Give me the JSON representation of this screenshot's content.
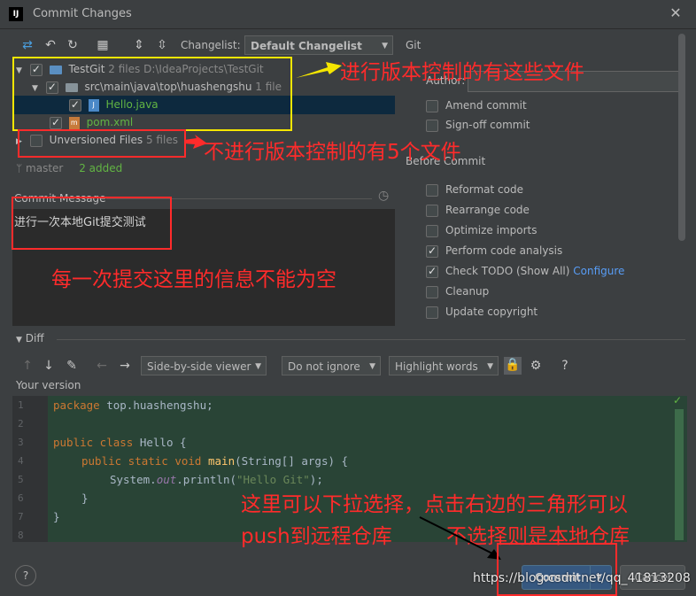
{
  "window": {
    "title": "Commit Changes",
    "close": "✕"
  },
  "toolbar": {
    "changelist_label": "Changelist:",
    "changelist_value": "Default Changelist",
    "git_label": "Git"
  },
  "tree": {
    "root": {
      "name": "TestGit",
      "count": "2 files",
      "path": "D:\\IdeaProjects\\TestGit"
    },
    "pkg": {
      "name": "src\\main\\java\\top\\huashengshu",
      "count": "1 file"
    },
    "file1": "Hello.java",
    "file2": "pom.xml",
    "unversioned": {
      "name": "Unversioned Files",
      "count": "5 files"
    }
  },
  "branch": {
    "name": "master",
    "status": "2 added"
  },
  "commit_message": {
    "label": "Commit Message",
    "value": "进行一次本地Git提交测试"
  },
  "right": {
    "author_label": "Author:",
    "amend": "Amend commit",
    "signoff": "Sign-off commit",
    "before_commit": "Before Commit",
    "reformat": "Reformat code",
    "rearrange": "Rearrange code",
    "optimize": "Optimize imports",
    "analysis": "Perform code analysis",
    "todo": "Check TODO (Show All)",
    "configure": "Configure",
    "cleanup": "Cleanup",
    "copyright": "Update copyright"
  },
  "diff": {
    "title": "Diff",
    "viewer": "Side-by-side viewer",
    "ignore": "Do not ignore",
    "highlight": "Highlight words",
    "help": "?",
    "your_version": "Your version"
  },
  "code": {
    "numbers": [
      "1",
      "2",
      "3",
      "4",
      "5",
      "6",
      "7",
      "8"
    ],
    "l1_kw": "package",
    "l1_rest": " top.huashengshu;",
    "l3_kw": "public class",
    "l3_rest": " Hello {",
    "l4_kw": "public static void",
    "l4_fn": "main",
    "l4_rest": "(String[] args) {",
    "l5_a": "System.",
    "l5_out": "out",
    "l5_b": ".println(",
    "l5_str": "\"Hello Git\"",
    "l5_c": ");",
    "l6": "}",
    "l7": "}"
  },
  "buttons": {
    "help": "?",
    "commit": "Commit",
    "commit_arrow": "▼",
    "cancel": "Cancel"
  },
  "annotations": {
    "a1": "进行版本控制的有这些文件",
    "a2": "不进行版本控制的有5个文件",
    "a3": "每一次提交这里的信息不能为空",
    "a4_line1": "这里可以下拉选择，点击右边的三角形可以",
    "a4_line2": "push到远程仓库",
    "a4_line3": "不选择则是本地仓库"
  },
  "watermark": "https://blog.csdn.net/qq_41813208"
}
